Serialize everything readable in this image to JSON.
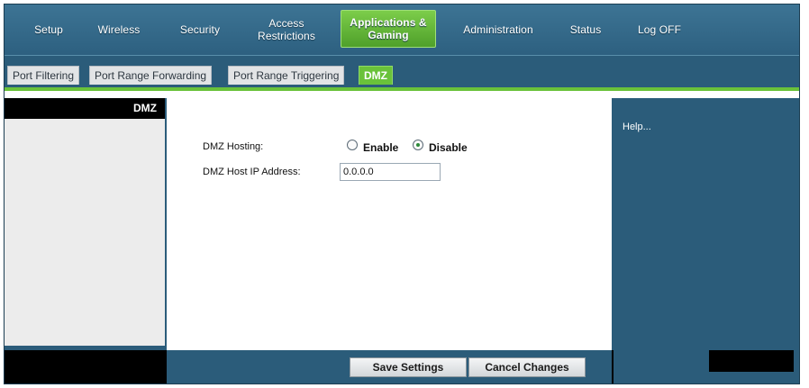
{
  "nav": {
    "items": [
      {
        "label": "Setup"
      },
      {
        "label": "Wireless"
      },
      {
        "label": "Security"
      },
      {
        "label": "Access Restrictions"
      },
      {
        "label": "Applications & Gaming",
        "active": true
      },
      {
        "label": "Administration"
      },
      {
        "label": "Status"
      },
      {
        "label": "Log OFF"
      }
    ]
  },
  "subnav": {
    "tabs": [
      {
        "label": "Port Filtering"
      },
      {
        "label": "Port Range Forwarding"
      },
      {
        "label": "Port Range Triggering"
      },
      {
        "label": "DMZ",
        "active": true
      }
    ]
  },
  "left": {
    "header": "DMZ"
  },
  "form": {
    "hosting_label": "DMZ Hosting:",
    "enable_label": "Enable",
    "disable_label": "Disable",
    "hosting_value": "Disable",
    "ip_label": "DMZ Host IP Address:",
    "ip_value": "0.0.0.0"
  },
  "help": {
    "text": "Help..."
  },
  "footer": {
    "save_label": "Save Settings",
    "cancel_label": "Cancel Changes"
  },
  "colors": {
    "nav_bg": "#2d6080",
    "accent_green": "#6ac23a",
    "panel_black": "#000000"
  }
}
